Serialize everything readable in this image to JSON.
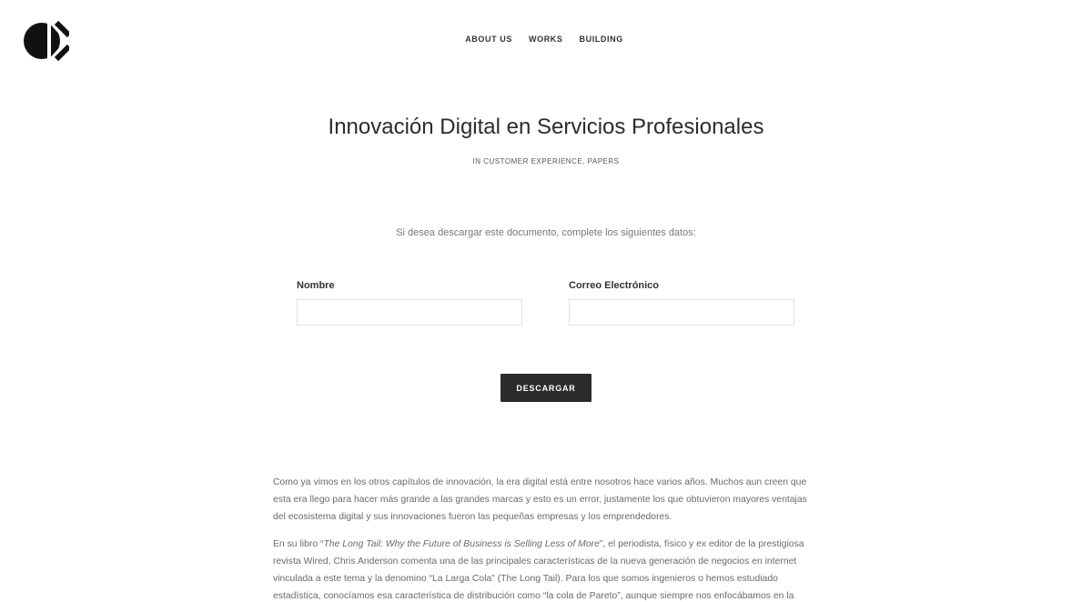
{
  "header": {
    "logo_icon": "brand-logo-icon",
    "nav": [
      {
        "label": "ABOUT US"
      },
      {
        "label": "WORKS"
      },
      {
        "label": "BUILDING"
      }
    ]
  },
  "post": {
    "title": "Innovación Digital en Servicios Profesionales",
    "meta": "IN CUSTOMER EXPERIENCE, PAPERS"
  },
  "download_form": {
    "intro": "Si desea descargar este documento, complete los siguientes datos:",
    "name_label": "Nombre",
    "name_value": "",
    "email_label": "Correo Electrónico",
    "email_value": "",
    "submit_label": "DESCARGAR"
  },
  "article": {
    "p1": "Como ya vimos en los otros capítulos de innovación, la era digital está entre nosotros hace varios años. Muchos aun creen que esta era llego para hacer más grande a las grandes marcas y esto es un error, justamente los que obtuvieron mayores ventajas del ecosistema digital y sus innovaciones fueron las pequeñas empresas y los emprendedores.",
    "p2_before": "En su libro “",
    "p2_book": "The Long Tail: Why the Future of Business is Selling Less of More",
    "p2_after": "”, el periodista, físico y ex editor de la prestigiosa revista Wired, Chris Anderson comenta una de las principales características de la nueva generación de negocios en internet vinculada a este tema y la denomino “La Larga Cola” (The Long Tail). Para los que somos ingenieros o hemos estudiado estadística, conocíamos esa característica de distribución como “la cola de Pareto”, aunque siempre nos enfocábamos en la “Cabeza de Pareto” centrada en el"
  }
}
